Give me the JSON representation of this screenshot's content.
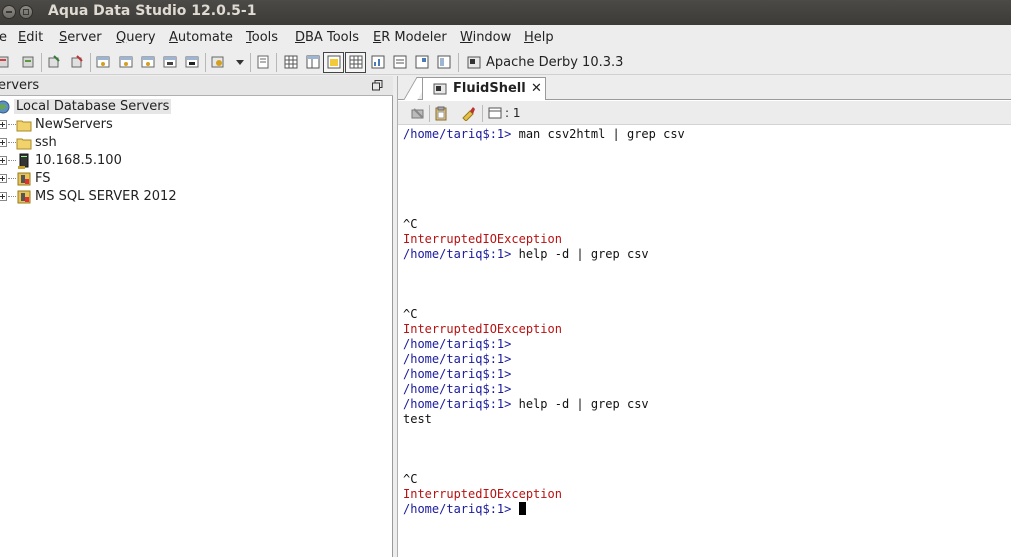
{
  "window": {
    "title": "Aqua Data Studio 12.0.5-1"
  },
  "menu": {
    "items": [
      {
        "label": "e",
        "u": ""
      },
      {
        "label": "dit",
        "u": "E"
      },
      {
        "label": "erver",
        "u": "S"
      },
      {
        "label": "uery",
        "u": "Q"
      },
      {
        "label": "utomate",
        "u": "A"
      },
      {
        "label": "ools",
        "u": "T"
      },
      {
        "label": "BA Tools",
        "u": "D"
      },
      {
        "label": "R Modeler",
        "u": "E"
      },
      {
        "label": "indow",
        "u": "W"
      },
      {
        "label": "elp",
        "u": "H"
      }
    ]
  },
  "toolbar": {
    "db_label": "Apache Derby 10.3.3"
  },
  "servers_panel": {
    "header": "ervers",
    "root": "Local Database Servers",
    "items": [
      {
        "label": "NewServers",
        "icon": "folder-icon"
      },
      {
        "label": "ssh",
        "icon": "folder-icon"
      },
      {
        "label": "10.168.5.100",
        "icon": "server-icon"
      },
      {
        "label": "FS",
        "icon": "db-folder-icon"
      },
      {
        "label": "MS SQL SERVER 2012",
        "icon": "db-folder-icon"
      }
    ]
  },
  "shell": {
    "tab_label": "FluidShell",
    "tab_close": "✕",
    "count": ": 1",
    "prompt": "/home/tariq$:1>",
    "lines": [
      {
        "prompt": "/home/tariq$:1>",
        "cmd": " man csv2html | grep csv"
      },
      {
        "text": "^C"
      },
      {
        "error": "InterruptedIOException"
      },
      {
        "prompt": "/home/tariq$:1>",
        "cmd": " help -d | grep csv"
      },
      {
        "text": "^C"
      },
      {
        "error": "InterruptedIOException"
      },
      {
        "prompt": "/home/tariq$:1>",
        "cmd": ""
      },
      {
        "prompt": "/home/tariq$:1>",
        "cmd": ""
      },
      {
        "prompt": "/home/tariq$:1>",
        "cmd": ""
      },
      {
        "prompt": "/home/tariq$:1>",
        "cmd": ""
      },
      {
        "prompt": "/home/tariq$:1>",
        "cmd": " help -d | grep csv"
      },
      {
        "text": "test"
      },
      {
        "text": "^C"
      },
      {
        "error": "InterruptedIOException"
      },
      {
        "prompt": "/home/tariq$:1>",
        "cmd": " "
      }
    ]
  }
}
